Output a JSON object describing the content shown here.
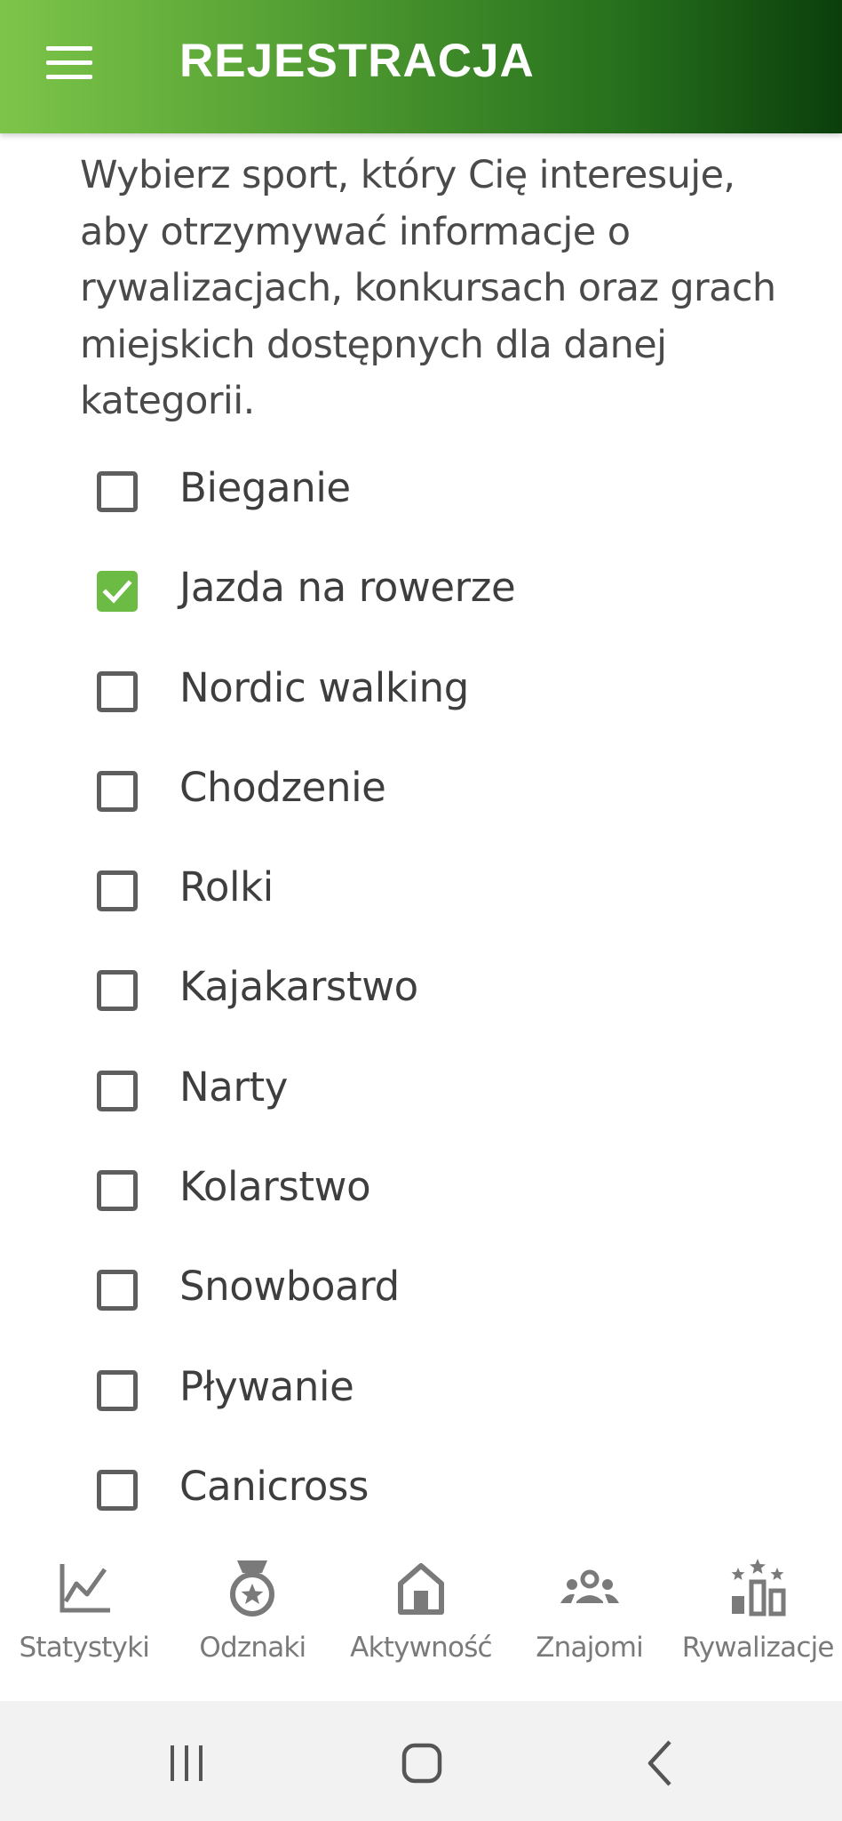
{
  "header": {
    "title": "REJESTRACJA",
    "menu_icon": "hamburger-menu-icon",
    "gradient_colors": [
      "#7dc54a",
      "#0b3e0b"
    ]
  },
  "intro_text": "Wybierz sport, który Cię interesuje, aby otrzymywać informacje o rywalizacjach, konkursach oraz grach miejskich dostępnych dla danej kategorii.",
  "sports": [
    {
      "label": "Bieganie",
      "checked": false
    },
    {
      "label": "Jazda na rowerze",
      "checked": true
    },
    {
      "label": "Nordic walking",
      "checked": false
    },
    {
      "label": "Chodzenie",
      "checked": false
    },
    {
      "label": "Rolki",
      "checked": false
    },
    {
      "label": "Kajakarstwo",
      "checked": false
    },
    {
      "label": "Narty",
      "checked": false
    },
    {
      "label": "Kolarstwo",
      "checked": false
    },
    {
      "label": "Snowboard",
      "checked": false
    },
    {
      "label": "Pływanie",
      "checked": false
    },
    {
      "label": "Canicross",
      "checked": false
    }
  ],
  "bottom_nav": [
    {
      "label": "Statystyki",
      "icon": "chart-line-icon"
    },
    {
      "label": "Odznaki",
      "icon": "medal-icon"
    },
    {
      "label": "Aktywność",
      "icon": "home-icon"
    },
    {
      "label": "Znajomi",
      "icon": "group-icon"
    },
    {
      "label": "Rywalizacje",
      "icon": "podium-stars-icon"
    }
  ],
  "system_nav": [
    {
      "icon": "recent-apps-icon"
    },
    {
      "icon": "home-circle-icon"
    },
    {
      "icon": "back-icon"
    }
  ],
  "colors": {
    "accent": "#6cbb45",
    "text": "#3e3e3e",
    "nav_label": "#7a7a7a"
  }
}
